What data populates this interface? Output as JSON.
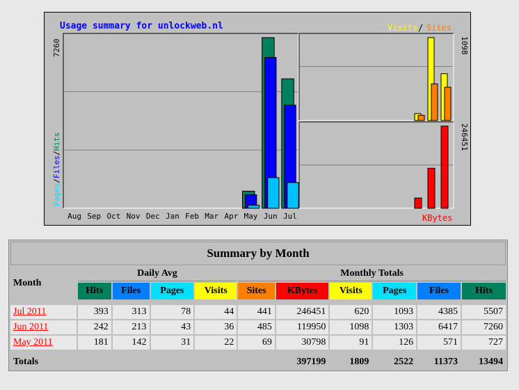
{
  "chart_data": {
    "type": "bar",
    "title": "Usage summary for unlockweb.nl",
    "months": [
      "Aug",
      "Sep",
      "Oct",
      "Nov",
      "Dec",
      "Jan",
      "Feb",
      "Mar",
      "Apr",
      "May",
      "Jun",
      "Jul"
    ],
    "main_panel": {
      "ylabel_parts": [
        "Pages",
        "/",
        "Files",
        "/",
        "Hits"
      ],
      "ymax_label": "7260",
      "ylim": [
        0,
        7260
      ],
      "series": [
        {
          "name": "Hits",
          "color": "#00805c",
          "values": [
            0,
            0,
            0,
            0,
            0,
            0,
            0,
            0,
            0,
            727,
            7260,
            5507
          ]
        },
        {
          "name": "Files",
          "color": "#0000ff",
          "values": [
            0,
            0,
            0,
            0,
            0,
            0,
            0,
            0,
            0,
            571,
            6417,
            4385
          ]
        },
        {
          "name": "Pages",
          "color": "#00c0ff",
          "values": [
            0,
            0,
            0,
            0,
            0,
            0,
            0,
            0,
            0,
            126,
            1303,
            1093
          ]
        }
      ]
    },
    "visits_panel": {
      "legend_parts": [
        "Visits",
        "/",
        "Sites"
      ],
      "ymax_label": "1098",
      "ylim": [
        0,
        1098
      ],
      "series": [
        {
          "name": "Visits",
          "color": "#ffff00",
          "values": [
            91,
            1098,
            620
          ]
        },
        {
          "name": "Sites",
          "color": "#ff8000",
          "values": [
            69,
            485,
            441
          ]
        }
      ]
    },
    "kbytes_panel": {
      "legend": "KBytes",
      "ymax_label": "246451",
      "ylim": [
        0,
        246451
      ],
      "series": [
        {
          "name": "KBytes",
          "color": "#ff0000",
          "values": [
            30798,
            119950,
            246451
          ]
        }
      ]
    }
  },
  "colors": {
    "hits": "#00805c",
    "files": "#0080ff",
    "pages": "#00e0ff",
    "visits": "#ffff00",
    "sites": "#ff8000",
    "kbytes": "#ff0000",
    "title": "#0000ff"
  },
  "table": {
    "title": "Summary by Month",
    "month_header": "Month",
    "daily_avg_header": "Daily Avg",
    "monthly_totals_header": "Monthly Totals",
    "daily_cols": [
      "Hits",
      "Files",
      "Pages",
      "Visits"
    ],
    "monthly_cols": [
      "Sites",
      "KBytes",
      "Visits",
      "Pages",
      "Files",
      "Hits"
    ],
    "rows": [
      {
        "month": "Jul 2011",
        "daily": [
          "393",
          "313",
          "78",
          "44"
        ],
        "monthly": [
          "441",
          "246451",
          "620",
          "1093",
          "4385",
          "5507"
        ]
      },
      {
        "month": "Jun 2011",
        "daily": [
          "242",
          "213",
          "43",
          "36"
        ],
        "monthly": [
          "485",
          "119950",
          "1098",
          "1303",
          "6417",
          "7260"
        ]
      },
      {
        "month": "May 2011",
        "daily": [
          "181",
          "142",
          "31",
          "22"
        ],
        "monthly": [
          "69",
          "30798",
          "91",
          "126",
          "571",
          "727"
        ]
      }
    ],
    "totals_label": "Totals",
    "totals": {
      "kbytes": "397199",
      "visits": "1809",
      "pages": "2522",
      "files": "11373",
      "hits": "13494"
    }
  }
}
